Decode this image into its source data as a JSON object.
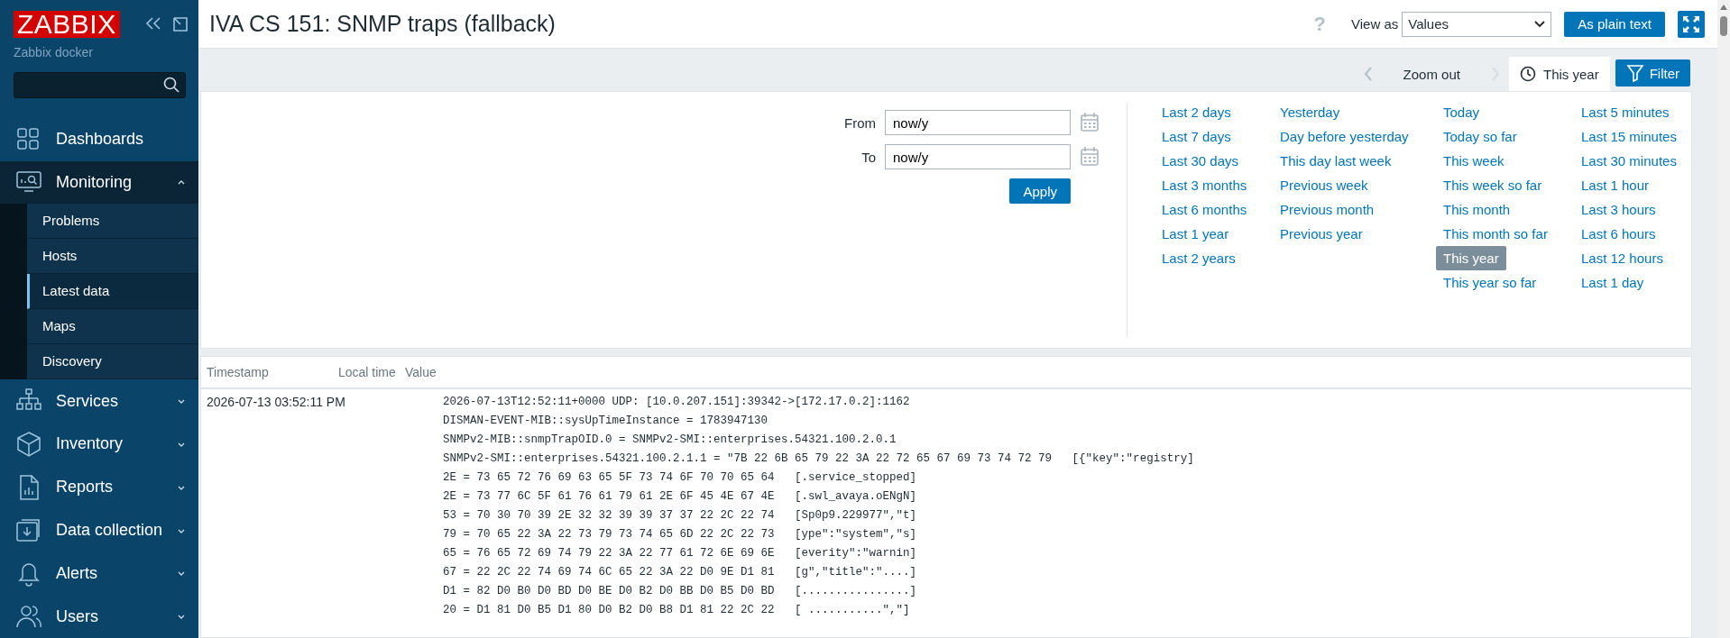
{
  "sidebar": {
    "logo": "ZABBIX",
    "server": "Zabbix docker",
    "menu": [
      {
        "label": "Dashboards",
        "kind": "dashboards"
      },
      {
        "label": "Monitoring",
        "kind": "monitoring",
        "expanded": true,
        "children": [
          {
            "label": "Problems",
            "selected": false
          },
          {
            "label": "Hosts",
            "selected": false
          },
          {
            "label": "Latest data",
            "selected": true
          },
          {
            "label": "Maps",
            "selected": false
          },
          {
            "label": "Discovery",
            "selected": false
          }
        ]
      },
      {
        "label": "Services",
        "kind": "services",
        "expanded": false
      },
      {
        "label": "Inventory",
        "kind": "inventory",
        "expanded": false
      },
      {
        "label": "Reports",
        "kind": "reports",
        "expanded": false
      },
      {
        "label": "Data collection",
        "kind": "datacollection",
        "expanded": false
      },
      {
        "label": "Alerts",
        "kind": "alerts",
        "expanded": false
      },
      {
        "label": "Users",
        "kind": "users",
        "expanded": false
      }
    ]
  },
  "header": {
    "title": "IVA CS 151: SNMP traps (fallback)",
    "help": "?",
    "view_as_label": "View as",
    "view_as_value": "Values",
    "plain_text_button": "As plain text"
  },
  "timebar": {
    "zoom_out": "Zoom out",
    "time_tab": {
      "label": "This year",
      "selected": true
    },
    "filter_tab": {
      "label": "Filter",
      "selected": true
    }
  },
  "filter": {
    "from_label": "From",
    "from_value": "now/y",
    "to_label": "To",
    "to_value": "now/y",
    "apply": "Apply",
    "quick_ranges": [
      [
        {
          "label": "Last 2 days",
          "selected": false
        },
        {
          "label": "Last 7 days",
          "selected": false
        },
        {
          "label": "Last 30 days",
          "selected": false
        },
        {
          "label": "Last 3 months",
          "selected": false
        },
        {
          "label": "Last 6 months",
          "selected": false
        },
        {
          "label": "Last 1 year",
          "selected": false
        },
        {
          "label": "Last 2 years",
          "selected": false
        }
      ],
      [
        {
          "label": "Yesterday",
          "selected": false
        },
        {
          "label": "Day before yesterday",
          "selected": false
        },
        {
          "label": "This day last week",
          "selected": false
        },
        {
          "label": "Previous week",
          "selected": false
        },
        {
          "label": "Previous month",
          "selected": false
        },
        {
          "label": "Previous year",
          "selected": false
        }
      ],
      [
        {
          "label": "Today",
          "selected": false
        },
        {
          "label": "Today so far",
          "selected": false
        },
        {
          "label": "This week",
          "selected": false
        },
        {
          "label": "This week so far",
          "selected": false
        },
        {
          "label": "This month",
          "selected": false
        },
        {
          "label": "This month so far",
          "selected": false
        },
        {
          "label": "This year",
          "selected": true
        },
        {
          "label": "This year so far",
          "selected": false
        }
      ],
      [
        {
          "label": "Last 5 minutes",
          "selected": false
        },
        {
          "label": "Last 15 minutes",
          "selected": false
        },
        {
          "label": "Last 30 minutes",
          "selected": false
        },
        {
          "label": "Last 1 hour",
          "selected": false
        },
        {
          "label": "Last 3 hours",
          "selected": false
        },
        {
          "label": "Last 6 hours",
          "selected": false
        },
        {
          "label": "Last 12 hours",
          "selected": false
        },
        {
          "label": "Last 1 day",
          "selected": false
        }
      ]
    ]
  },
  "table": {
    "columns": [
      "Timestamp",
      "Local time",
      "Value"
    ],
    "rows": [
      {
        "timestamp": "2026-07-13 03:52:11 PM",
        "value_lines": [
          "2026-07-13T12:52:11+0000 UDP: [10.0.207.151]:39342->[172.17.0.2]:1162",
          "DISMAN-EVENT-MIB::sysUpTimeInstance = 1783947130",
          "SNMPv2-MIB::snmpTrapOID.0 = SNMPv2-SMI::enterprises.54321.100.2.0.1",
          "SNMPv2-SMI::enterprises.54321.100.2.1.1 = \"7B 22 6B 65 79 22 3A 22 72 65 67 69 73 74 72 79   [{\"key\":\"registry]",
          "2E = 73 65 72 76 69 63 65 5F 73 74 6F 70 70 65 64   [.service_stopped]",
          "2E = 73 77 6C 5F 61 76 61 79 61 2E 6F 45 4E 67 4E   [.swl_avaya.oENgN]",
          "53 = 70 30 70 39 2E 32 32 39 39 37 37 22 2C 22 74   [Sp0p9.229977\",\"t]",
          "79 = 70 65 22 3A 22 73 79 73 74 65 6D 22 2C 22 73   [ype\":\"system\",\"s]",
          "65 = 76 65 72 69 74 79 22 3A 22 77 61 72 6E 69 6E   [everity\":\"warnin]",
          "67 = 22 2C 22 74 69 74 6C 65 22 3A 22 D0 9E D1 81   [g\",\"title\":\"....]",
          "D1 = 82 D0 B0 D0 BD D0 BE D0 B2 D0 BB D0 B5 D0 BD   [................]",
          "20 = D1 81 D0 B5 D1 80 D0 B2 D0 B8 D1 81 22 2C 22   [ ...........\",\"]"
        ]
      }
    ]
  }
}
